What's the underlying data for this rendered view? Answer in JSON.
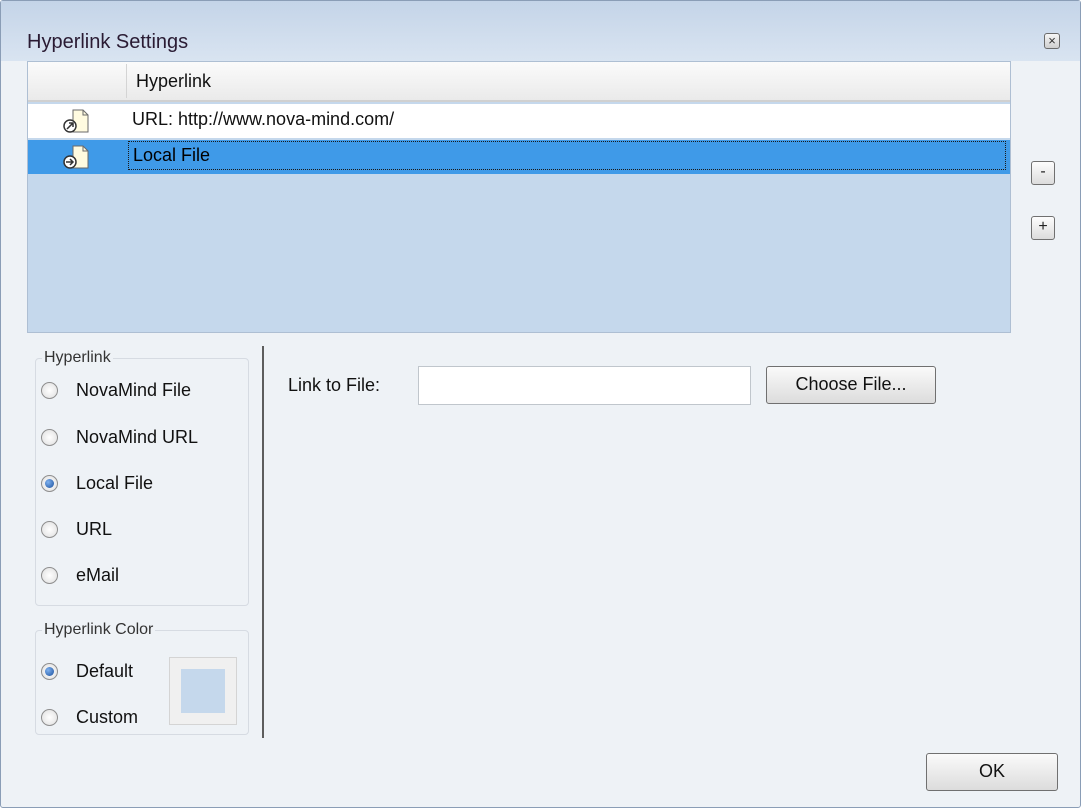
{
  "window": {
    "title": "Hyperlink Settings",
    "close_icon": "close-icon"
  },
  "list": {
    "column_header": "Hyperlink",
    "rows": [
      {
        "icon": "web-link-document-icon",
        "text": "URL: http://www.nova-mind.com/",
        "selected": false
      },
      {
        "icon": "local-file-document-icon",
        "text": "Local File",
        "selected": true
      }
    ],
    "remove_button": "-",
    "add_button": "+"
  },
  "hyperlink_group": {
    "legend": "Hyperlink",
    "options": [
      {
        "label": "NovaMind File",
        "checked": false
      },
      {
        "label": "NovaMind URL",
        "checked": false
      },
      {
        "label": "Local File",
        "checked": true
      },
      {
        "label": "URL",
        "checked": false
      },
      {
        "label": "eMail",
        "checked": false
      }
    ]
  },
  "color_group": {
    "legend": "Hyperlink Color",
    "options": [
      {
        "label": "Default",
        "checked": true
      },
      {
        "label": "Custom",
        "checked": false
      }
    ],
    "swatch_color": "#c5d8ec"
  },
  "link_to_file": {
    "label": "Link to File:",
    "value": "",
    "choose_button": "Choose File..."
  },
  "ok_button": "OK",
  "colors": {
    "list_background": "#c5d8ec",
    "selection": "#3f9ae8",
    "window_background": "#eef2f6"
  }
}
